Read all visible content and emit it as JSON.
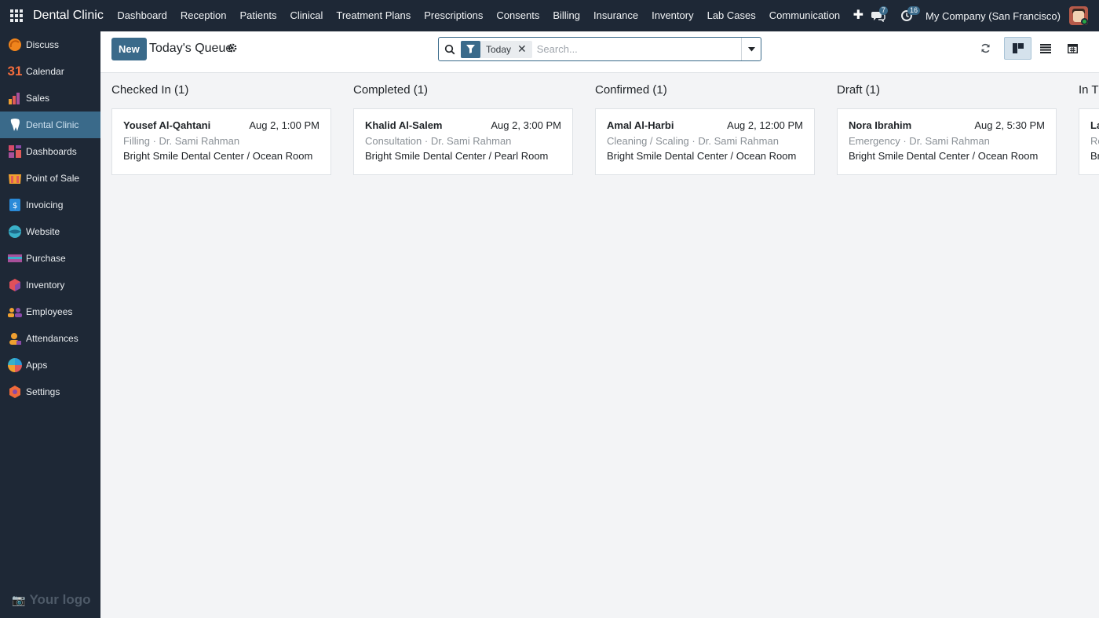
{
  "app": {
    "title": "Dental Clinic"
  },
  "topmenu": [
    {
      "label": "Dashboard"
    },
    {
      "label": "Reception"
    },
    {
      "label": "Patients"
    },
    {
      "label": "Clinical"
    },
    {
      "label": "Treatment Plans"
    },
    {
      "label": "Prescriptions"
    },
    {
      "label": "Consents"
    },
    {
      "label": "Billing"
    },
    {
      "label": "Insurance"
    },
    {
      "label": "Inventory"
    },
    {
      "label": "Lab Cases"
    },
    {
      "label": "Communication"
    }
  ],
  "systray": {
    "messages_count": "7",
    "activities_count": "16",
    "company": "My Company (San Francisco)"
  },
  "sidebar": {
    "items": [
      {
        "label": "Discuss",
        "icon": "discuss-icon",
        "color": "#f0841c"
      },
      {
        "label": "Calendar",
        "icon": "calendar-icon",
        "color": "#f36c3c"
      },
      {
        "label": "Sales",
        "icon": "sales-icon",
        "color": "#e05a5a"
      },
      {
        "label": "Dental Clinic",
        "icon": "tooth-icon",
        "color": "#ffffff",
        "active": true
      },
      {
        "label": "Dashboards",
        "icon": "dashboards-icon",
        "color": "#d64a6a"
      },
      {
        "label": "Point of Sale",
        "icon": "point-of-sale-icon",
        "color": "#f0a030"
      },
      {
        "label": "Invoicing",
        "icon": "invoicing-icon",
        "color": "#2a8ad8"
      },
      {
        "label": "Website",
        "icon": "website-icon",
        "color": "#3ab0c8"
      },
      {
        "label": "Purchase",
        "icon": "purchase-icon",
        "color": "#a8509a"
      },
      {
        "label": "Inventory",
        "icon": "inventory-icon",
        "color": "#e0505a"
      },
      {
        "label": "Employees",
        "icon": "employees-icon",
        "color": "#8a4aa8"
      },
      {
        "label": "Attendances",
        "icon": "attendances-icon",
        "color": "#f0a030"
      },
      {
        "label": "Apps",
        "icon": "apps-icon",
        "color": "#2a9ad8"
      },
      {
        "label": "Settings",
        "icon": "settings-icon",
        "color": "#f06a3a"
      }
    ],
    "logo_text": "Your logo"
  },
  "control": {
    "new_label": "New",
    "title": "Today's Queue",
    "facet_label": "Today",
    "search_placeholder": "Search..."
  },
  "kanban": {
    "columns": [
      {
        "title": "Checked In (1)",
        "card": {
          "name": "Yousef Al-Qahtani",
          "time": "Aug 2, 1:00 PM",
          "sub": "Filling · Dr. Sami Rahman",
          "loc": "Bright Smile Dental Center / Ocean Room"
        }
      },
      {
        "title": "Completed (1)",
        "card": {
          "name": "Khalid Al-Salem",
          "time": "Aug 2, 3:00 PM",
          "sub": "Consultation · Dr. Sami Rahman",
          "loc": "Bright Smile Dental Center / Pearl Room"
        }
      },
      {
        "title": "Confirmed (1)",
        "card": {
          "name": "Amal Al-Harbi",
          "time": "Aug 2, 12:00 PM",
          "sub": "Cleaning / Scaling · Dr. Sami Rahman",
          "loc": "Bright Smile Dental Center / Ocean Room"
        }
      },
      {
        "title": "Draft (1)",
        "card": {
          "name": "Nora Ibrahim",
          "time": "Aug 2, 5:30 PM",
          "sub": "Emergency · Dr. Sami Rahman",
          "loc": "Bright Smile Dental Center / Ocean Room"
        }
      },
      {
        "title": "In Tr",
        "card": {
          "name": "La",
          "time": "",
          "sub": "Ro",
          "loc": "Br"
        }
      }
    ]
  },
  "colors": {
    "navbar": "#1e2836",
    "accent": "#3a6a8a",
    "background": "#f3f4f6"
  }
}
